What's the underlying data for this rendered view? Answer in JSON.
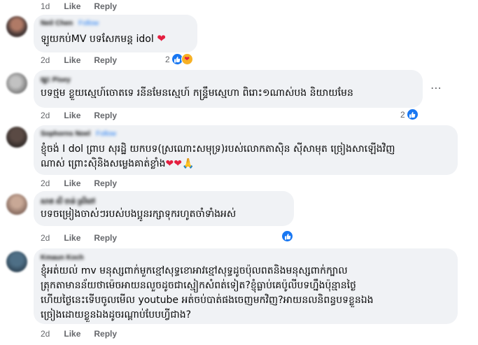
{
  "actions": {
    "like": "Like",
    "reply": "Reply"
  },
  "colors": {
    "accent": "#1877f2",
    "bubble": "#f0f2f5",
    "meta": "#65676b",
    "heart": "#e41e3f"
  },
  "comments": [
    {
      "time": "1d"
    },
    {
      "name": "Neil Chen",
      "follow": "Follow",
      "text": "ឡូយកប់MV បទសែកមន្ត idol",
      "emoji_end": "heart",
      "time": "2d",
      "reaction_count": "2",
      "reactions": [
        "like-icon",
        "care-icon"
      ]
    },
    {
      "name": "ម្លេះ Pisey",
      "text": "បទថ្មម ខ្លួយស្មេហ៍ចោតទេ រនីនមែនស្មេហ៍ កន្ទ្រឹមស្មេហា ពិរោះ១ណាស់បង និយាយមែន",
      "time": "2d",
      "reaction_count": "2",
      "reactions": [
        "like-icon"
      ],
      "menu": "⋯"
    },
    {
      "name": "Sophorns Noel",
      "follow": "Follow",
      "text_lines": [
        "ខ្ញុំចង់ I dol ព្រាប សុរដ្ឋិ យកបទ(ស្រណោះសមុទ្រ)របស់លោកតាស៊ិន ស៊ីសាមុត ច្រៀងសាឡើងវិញ",
        "ណាស់ ព្រោះស៊ិនិងសម្លេងគាត់ខ្លាំង"
      ],
      "emoji_end": "❤❤🙏",
      "time": "2d"
    },
    {
      "name": "សាត សី ចាន់ ស្រីពៅ",
      "text": "បទចម្រៀងចាស់ៗរបស់បងប្អូនរក្សាទុករហូតចាំទាំងអស់",
      "time": "2d",
      "reactions": [
        "like-icon"
      ]
    },
    {
      "name": "Kmaun Koch",
      "text_lines": [
        "ខ្ញុំអត់យល់ mv មនុស្សពាក់មួកខ្មៅសុទ្ធខោអាវខ្មៅសុទ្ធដូចប៉ុលពតនិងមនុស្សពាក់ក្បាល",
        "ត្រុកតាមានន័យថាម៉េចអាយនលួចដូចជាស្មៀកសំពត់ទៀត?ខ្ញុំធ្លាប់គេប៉ូលីបទហ្នឹងប៉ុន្មានថ្ងៃ",
        "ហើយថ្ងៃនេះទើបចូលមើល youtube អត់ចប់បាត់ផងចេញមកវិញ?អាយនលនិពន្ធបទខ្លួនឯង",
        "ច្រៀងដោយខ្លួនឯងដូចរណ្ដាប់បែបហ្វីជាង?"
      ],
      "time": "2d"
    }
  ]
}
